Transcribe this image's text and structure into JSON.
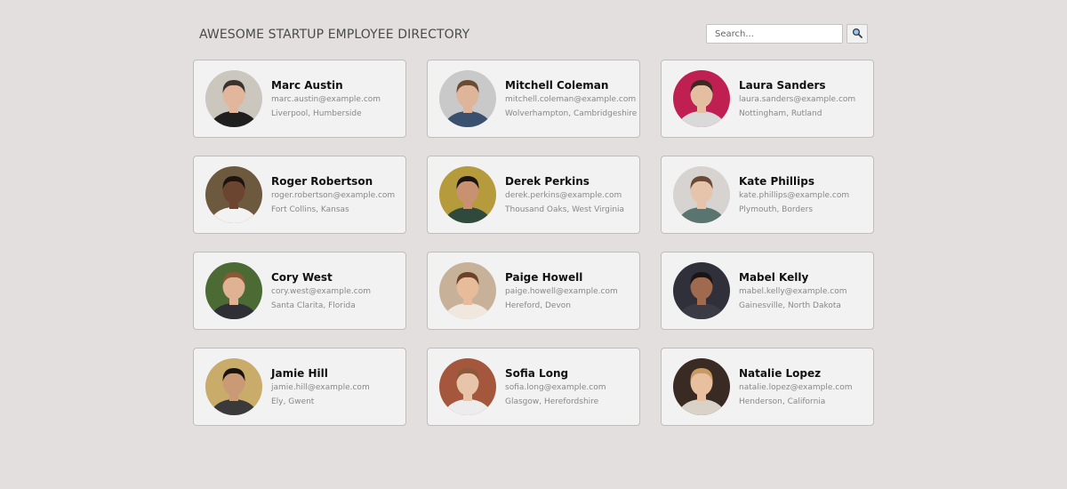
{
  "header": {
    "title": "AWESOME STARTUP EMPLOYEE DIRECTORY"
  },
  "search": {
    "placeholder": "Search...",
    "value": "",
    "button_icon": "search-icon"
  },
  "employees": [
    {
      "name": "Marc Austin",
      "email": "marc.austin@example.com",
      "location": "Liverpool, Humberside",
      "bg": "#cbc6be",
      "hair": "#3a322c",
      "skin": "#e2b69c",
      "shirt": "#1f1f1f"
    },
    {
      "name": "Mitchell Coleman",
      "email": "mitchell.coleman@example.com",
      "location": "Wolverhampton, Cambridgeshire",
      "bg": "#c9c9c9",
      "hair": "#6b4b32",
      "skin": "#deb59b",
      "shirt": "#39506f"
    },
    {
      "name": "Laura Sanders",
      "email": "laura.sanders@example.com",
      "location": "Nottingham, Rutland",
      "bg": "#c01f52",
      "hair": "#3b2a22",
      "skin": "#e4bea1",
      "shirt": "#d9d9d9"
    },
    {
      "name": "Roger Robertson",
      "email": "roger.robertson@example.com",
      "location": "Fort Collins, Kansas",
      "bg": "#6d5a3e",
      "hair": "#1c1410",
      "skin": "#6b4530",
      "shirt": "#f2f2f2"
    },
    {
      "name": "Derek Perkins",
      "email": "derek.perkins@example.com",
      "location": "Thousand Oaks, West Virginia",
      "bg": "#b59b3b",
      "hair": "#1b1612",
      "skin": "#c89272",
      "shirt": "#2f4a3c"
    },
    {
      "name": "Kate Phillips",
      "email": "kate.phillips@example.com",
      "location": "Plymouth, Borders",
      "bg": "#d6d3d1",
      "hair": "#6a4a37",
      "skin": "#e6c3ab",
      "shirt": "#5a7470"
    },
    {
      "name": "Cory West",
      "email": "cory.west@example.com",
      "location": "Santa Clarita, Florida",
      "bg": "#4c6a33",
      "hair": "#8a5a35",
      "skin": "#e0b294",
      "shirt": "#2f2f36"
    },
    {
      "name": "Paige Howell",
      "email": "paige.howell@example.com",
      "location": "Hereford, Devon",
      "bg": "#c7b299",
      "hair": "#6a4328",
      "skin": "#e6bc9a",
      "shirt": "#f0e8de"
    },
    {
      "name": "Mabel Kelly",
      "email": "mabel.kelly@example.com",
      "location": "Gainesville, North Dakota",
      "bg": "#30303a",
      "hair": "#1a1414",
      "skin": "#a06a4f",
      "shirt": "#3b3b45"
    },
    {
      "name": "Jamie Hill",
      "email": "jamie.hill@example.com",
      "location": "Ely, Gwent",
      "bg": "#c9ab6a",
      "hair": "#1a1410",
      "skin": "#c99a75",
      "shirt": "#3a3a3a"
    },
    {
      "name": "Sofia Long",
      "email": "sofia.long@example.com",
      "location": "Glasgow, Herefordshire",
      "bg": "#a4573c",
      "hair": "#8a5a3a",
      "skin": "#e8c4aa",
      "shirt": "#ececec"
    },
    {
      "name": "Natalie Lopez",
      "email": "natalie.lopez@example.com",
      "location": "Henderson, California",
      "bg": "#3a2a24",
      "hair": "#c89a62",
      "skin": "#e8c0a0",
      "shirt": "#d9d2c9"
    }
  ]
}
